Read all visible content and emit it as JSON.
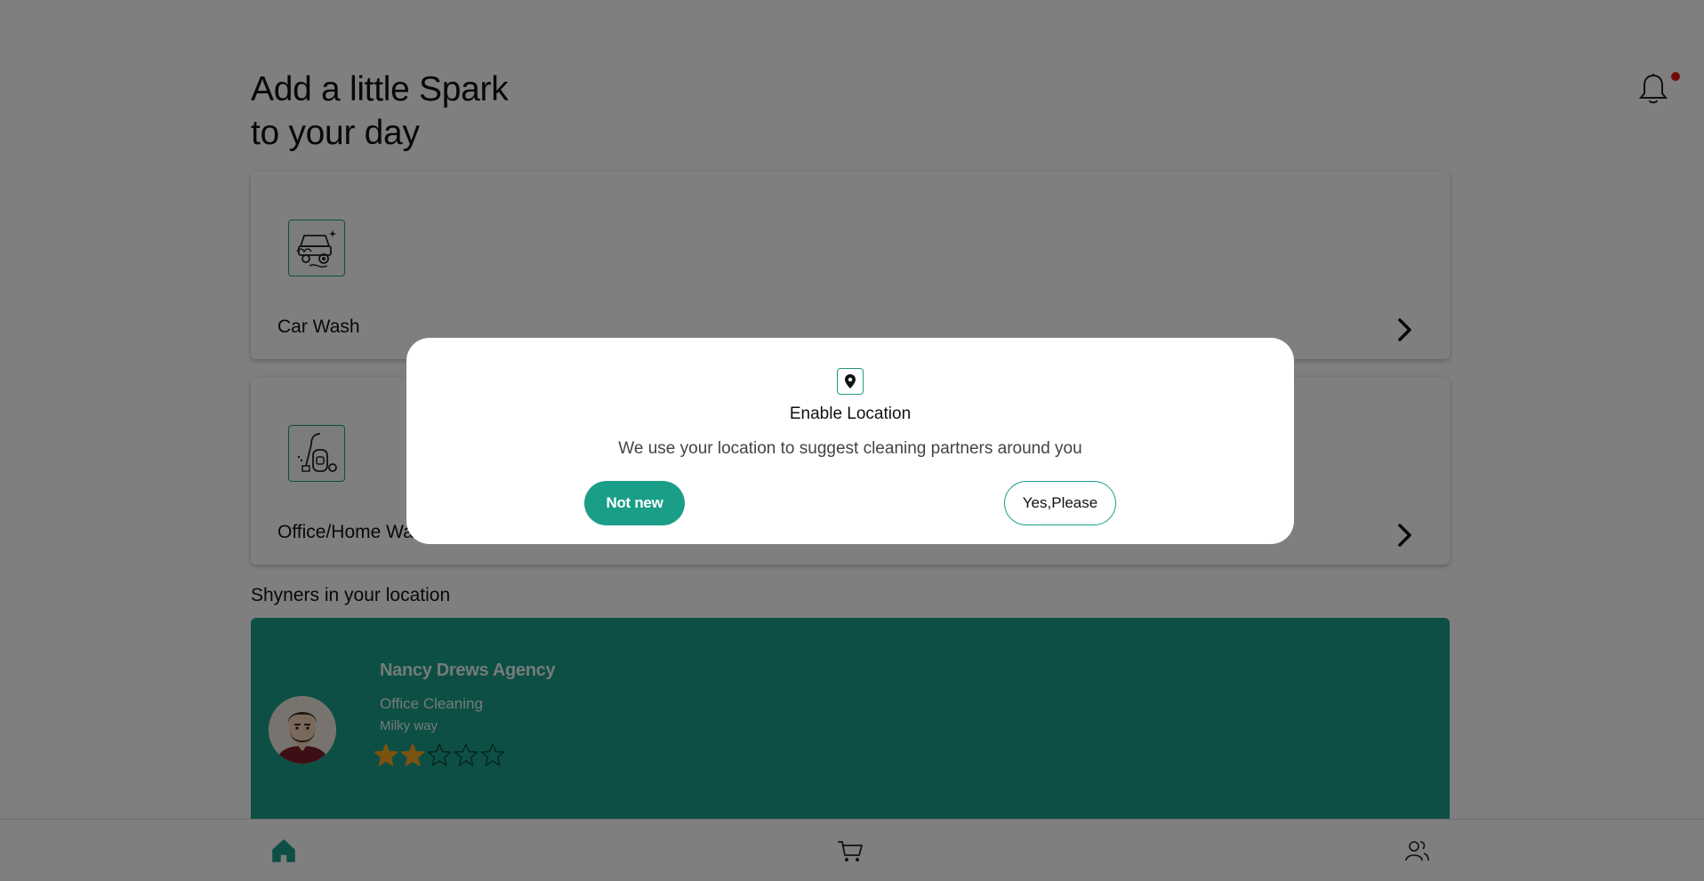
{
  "header": {
    "headline_line1": "Add a little Spark",
    "headline_line2": "to your day",
    "notification_icon": "bell-icon"
  },
  "services": [
    {
      "label": "Car Wash",
      "icon": "car-wash-icon"
    },
    {
      "label": "Office/Home Wash",
      "icon": "vacuum-cleaner-icon"
    }
  ],
  "section": {
    "title": "Shyners in your location"
  },
  "agency": {
    "name": "Nancy Drews Agency",
    "type": "Office Cleaning",
    "location": "Milky way",
    "rating": 2,
    "rating_max": 5
  },
  "bottom_nav": {
    "items": [
      "home-icon",
      "cart-icon",
      "profile-icon"
    ],
    "active": "home-icon"
  },
  "modal": {
    "title": "Enable Location",
    "message": "We use your location to suggest cleaning partners around you",
    "decline_label": "Not new",
    "accept_label": "Yes,Please"
  },
  "colors": {
    "accent": "#1b9e88",
    "star": "#f5a623",
    "notification_dot": "#e01414",
    "overlay": "rgba(0,0,0,0.5)"
  }
}
